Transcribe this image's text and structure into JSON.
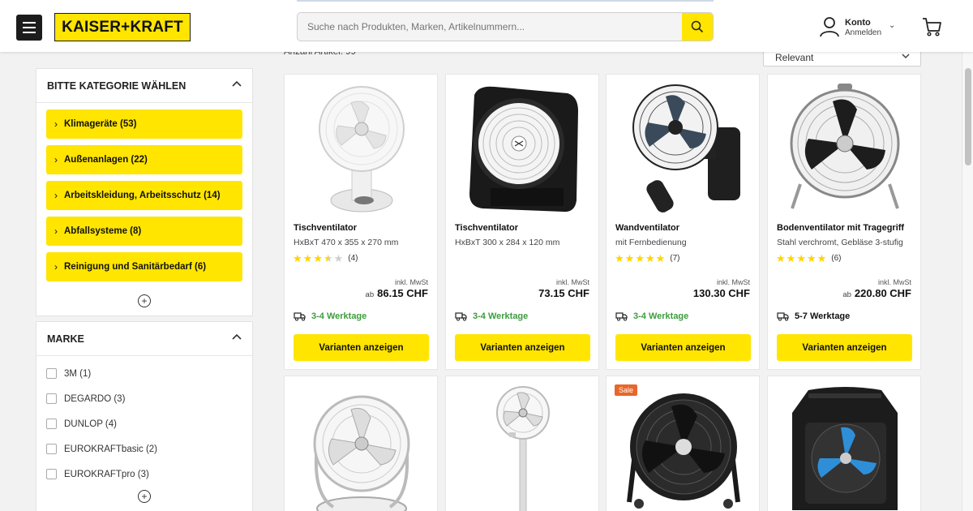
{
  "header": {
    "logo_text": "KAISER+KRAFT",
    "search_placeholder": "Suche nach Produkten, Marken, Artikelnummern...",
    "account_label": "Konto",
    "account_sub": "Anmelden",
    "menu_icon": "hamburger-menu-icon",
    "cart_icon": "shopping-cart-icon",
    "accent_color": "#ffe500"
  },
  "results": {
    "count_label": "Anzahl Artikel: 99",
    "sort_value": "Relevant"
  },
  "categories": {
    "title": "BITTE KATEGORIE WÄHLEN",
    "items": [
      {
        "label": "Klimageräte (53)"
      },
      {
        "label": "Außenanlagen (22)"
      },
      {
        "label": "Arbeitskleidung, Arbeitsschutz (14)"
      },
      {
        "label": "Abfallsysteme (8)"
      },
      {
        "label": "Reinigung und Sanitärbedarf (6)"
      }
    ]
  },
  "brands": {
    "title": "MARKE",
    "items": [
      {
        "label": "3M (1)"
      },
      {
        "label": "DEGARDO (3)"
      },
      {
        "label": "DUNLOP (4)"
      },
      {
        "label": "EUROKRAFTbasic (2)"
      },
      {
        "label": "EUROKRAFTpro (3)"
      }
    ]
  },
  "products": [
    {
      "name": "Tischventilator",
      "desc": "HxBxT 470 x 355 x 270 mm",
      "rating": 3.5,
      "reviews": "(4)",
      "mwst": "inkl. MwSt",
      "price_prefix": "ab",
      "price": "86.15 CHF",
      "delivery": "3-4 Werktage",
      "delivery_color": "#3d9c3d",
      "button": "Varianten anzeigen"
    },
    {
      "name": "Tischventilator",
      "desc": "HxBxT 300 x 284 x 120 mm",
      "rating": 0,
      "reviews": "",
      "mwst": "inkl. MwSt",
      "price_prefix": "",
      "price": "73.15 CHF",
      "delivery": "3-4 Werktage",
      "delivery_color": "#3d9c3d",
      "button": "Varianten anzeigen"
    },
    {
      "name": "Wandventilator",
      "desc": "mit Fernbedienung",
      "rating": 5,
      "reviews": "(7)",
      "mwst": "inkl. MwSt",
      "price_prefix": "",
      "price": "130.30 CHF",
      "delivery": "3-4 Werktage",
      "delivery_color": "#3d9c3d",
      "button": "Varianten anzeigen"
    },
    {
      "name": "Bodenventilator mit Tragegriff",
      "desc": "Stahl verchromt, Gebläse 3-stufig",
      "rating": 5,
      "reviews": "(6)",
      "mwst": "inkl. MwSt",
      "price_prefix": "ab",
      "price": "220.80 CHF",
      "delivery": "5-7 Werktage",
      "delivery_color": "#111111",
      "button": "Varianten anzeigen"
    }
  ],
  "products_row2": [
    {
      "badge": ""
    },
    {
      "badge": ""
    },
    {
      "badge": "Sale"
    },
    {
      "badge": ""
    }
  ]
}
